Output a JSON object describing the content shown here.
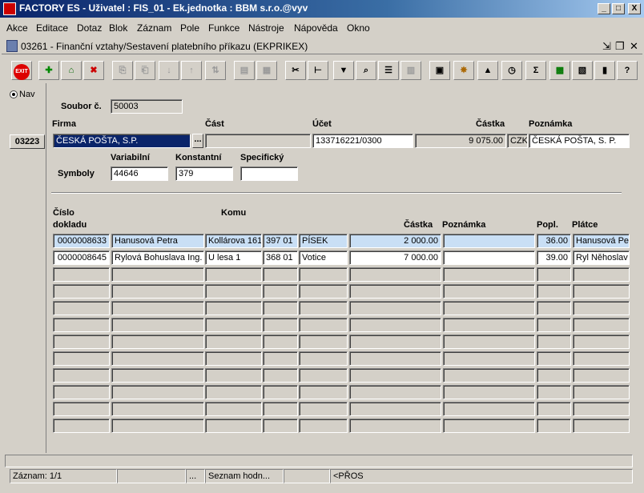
{
  "window": {
    "title": "FACTORY ES - Uživatel : FIS_01 - Ek.jednotka : BBM s.r.o.@vyv",
    "controls": [
      "_",
      "□",
      "X"
    ]
  },
  "menu": [
    "Akce",
    "Editace",
    "Dotaz",
    "Blok",
    "Záznam",
    "Pole",
    "Funkce",
    "Nástroje",
    "Nápověda",
    "Okno"
  ],
  "inner_window": {
    "title": "03261 - Finanční vztahy/Sestavení platebního příkazu (EKPRIKEX)"
  },
  "toolbar": {
    "exit_label": "EXIT",
    "icons": [
      "add-record-icon",
      "save-icon",
      "delete-icon",
      "copy-icon",
      "paste-icon",
      "sort-asc-icon",
      "sort-desc-icon",
      "sort-icon",
      "print-icon",
      "print-preview-icon",
      "cut-icon",
      "tree-icon",
      "filter-icon",
      "search-icon",
      "list-icon",
      "columns-icon",
      "calculator-icon",
      "wheel-icon",
      "triangle-icon",
      "clock-icon",
      "sum-icon",
      "excel-icon",
      "report-icon",
      "chart-icon",
      "help-icon",
      "context-help-icon"
    ],
    "sum_label": "Σ",
    "help_label": "?"
  },
  "left_panel": {
    "nav_label": "Nav",
    "code": "03223"
  },
  "header": {
    "soubor_label": "Soubor č.",
    "soubor_value": "50003",
    "firma_label": "Firma",
    "firma_value": "ČESKÁ POŠTA, S.P.",
    "lov_label": "...",
    "cast_label": "Část",
    "cast_value": "",
    "ucet_label": "Účet",
    "ucet_value": "133716221/0300",
    "ucet_extra": "",
    "castka_label": "Částka",
    "castka_value": "9 075.00",
    "mena_value": "CZK",
    "poznamka_label": "Poznámka",
    "poznamka_value": "ČESKÁ POŠTA, S. P.",
    "symboly_label": "Symboly",
    "variabilni_label": "Variabilní",
    "variabilni_value": "44646",
    "konstantni_label": "Konstantní",
    "konstantni_value": "379",
    "specificky_label": "Specifický",
    "specificky_value": ""
  },
  "table": {
    "headers": {
      "cislo_line1": "Číslo",
      "cislo_line2": "dokladu",
      "komu": "Komu",
      "castka": "Částka",
      "poznamka": "Poznámka",
      "popl": "Popl.",
      "platce": "Plátce"
    },
    "rows": [
      {
        "doklad": "0000008633",
        "jmeno": "Hanusová Petra",
        "ulice": "Kollárova 161",
        "psc": "397 01",
        "mesto": "PÍSEK",
        "castka": "2 000.00",
        "poznamka": "",
        "popl": "36.00",
        "platce": "Hanusová Pet"
      },
      {
        "doklad": "0000008645",
        "jmeno": "Rylová Bohuslava Ing.",
        "ulice": "U lesa 1",
        "psc": "368 01",
        "mesto": "Votice",
        "castka": "7 000.00",
        "poznamka": "",
        "popl": "39.00",
        "platce": "Ryl Něhoslav I"
      }
    ],
    "empty_rows": 10
  },
  "status": {
    "zaznam": "Záznam: 1/1",
    "seg2": "",
    "seg3": "...",
    "seznam": "Seznam hodn...",
    "seg5": "",
    "pros": "<PŘOS"
  }
}
